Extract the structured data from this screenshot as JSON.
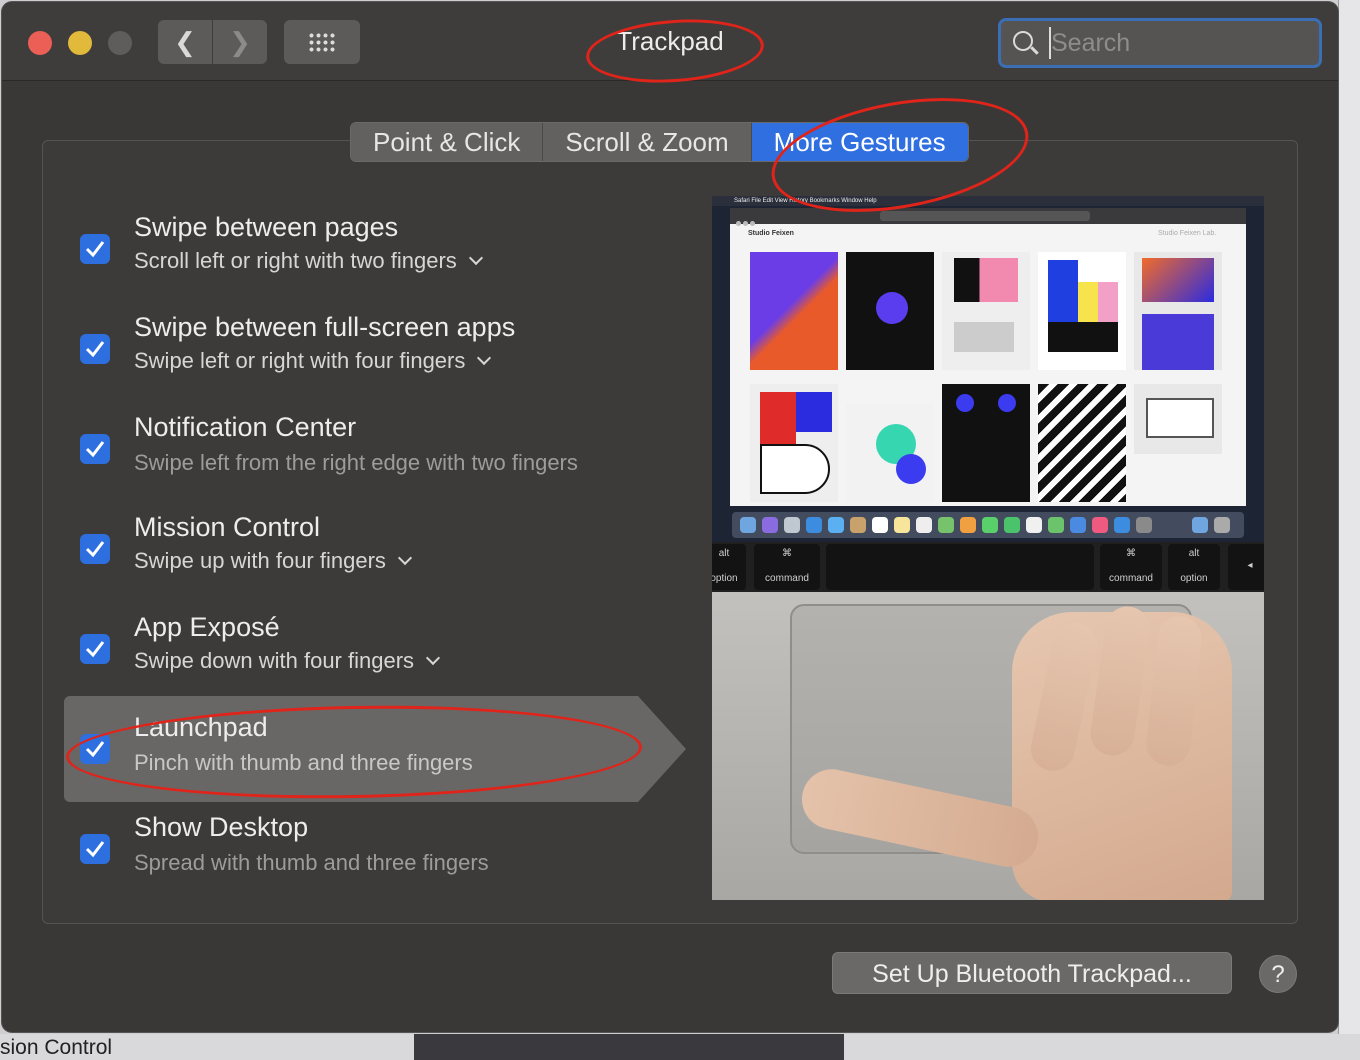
{
  "window": {
    "title": "Trackpad",
    "search": {
      "placeholder": "Search",
      "value": ""
    }
  },
  "tabs": [
    {
      "label": "Point & Click",
      "active": false
    },
    {
      "label": "Scroll & Zoom",
      "active": false
    },
    {
      "label": "More Gestures",
      "active": true
    }
  ],
  "gestures": [
    {
      "title": "Swipe between pages",
      "subtitle": "Scroll left or right with two fingers",
      "checked": true,
      "has_menu": true
    },
    {
      "title": "Swipe between full-screen apps",
      "subtitle": "Swipe left or right with four fingers",
      "checked": true,
      "has_menu": true
    },
    {
      "title": "Notification Center",
      "subtitle": "Swipe left from the right edge with two fingers",
      "checked": true,
      "has_menu": false
    },
    {
      "title": "Mission Control",
      "subtitle": "Swipe up with four fingers",
      "checked": true,
      "has_menu": true
    },
    {
      "title": "App Exposé",
      "subtitle": "Swipe down with four fingers",
      "checked": true,
      "has_menu": true
    },
    {
      "title": "Launchpad",
      "subtitle": "Pinch with thumb and three fingers",
      "checked": true,
      "has_menu": false,
      "selected": true
    },
    {
      "title": "Show Desktop",
      "subtitle": "Spread with thumb and three fingers",
      "checked": true,
      "has_menu": false
    }
  ],
  "preview": {
    "menubar": "Safari   File   Edit   View   History   Bookmarks   Window   Help",
    "site_title": "Studio Feixen",
    "site_right": "Studio Feixen Lab.",
    "keys": [
      {
        "symbol": "alt",
        "label": "option"
      },
      {
        "symbol": "⌘",
        "label": "command"
      },
      {
        "symbol": "⌘",
        "label": "command"
      },
      {
        "symbol": "alt",
        "label": "option"
      },
      {
        "symbol": "◂",
        "label": ""
      }
    ]
  },
  "buttons": {
    "setup_bluetooth": "Set Up Bluetooth Trackpad...",
    "help": "?"
  },
  "desktop": {
    "label": "sion Control"
  },
  "colors": {
    "accent": "#2f6fe0",
    "window_bg": "#3a3837",
    "annotation": "#e0241a"
  }
}
